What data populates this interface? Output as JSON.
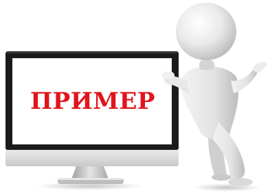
{
  "screen": {
    "word": "ПРИМЕР"
  },
  "colors": {
    "word": "#e0141c",
    "monitor_frame": "#1a1a1a",
    "screen_background": "#ffffff",
    "monitor_chin": "#d9d9d9",
    "stand": "#c4c4c4",
    "figure": "#e6e6e6"
  },
  "illustration": {
    "subject": "3d-person-leaning-on-monitor",
    "pose": "shrugging"
  }
}
